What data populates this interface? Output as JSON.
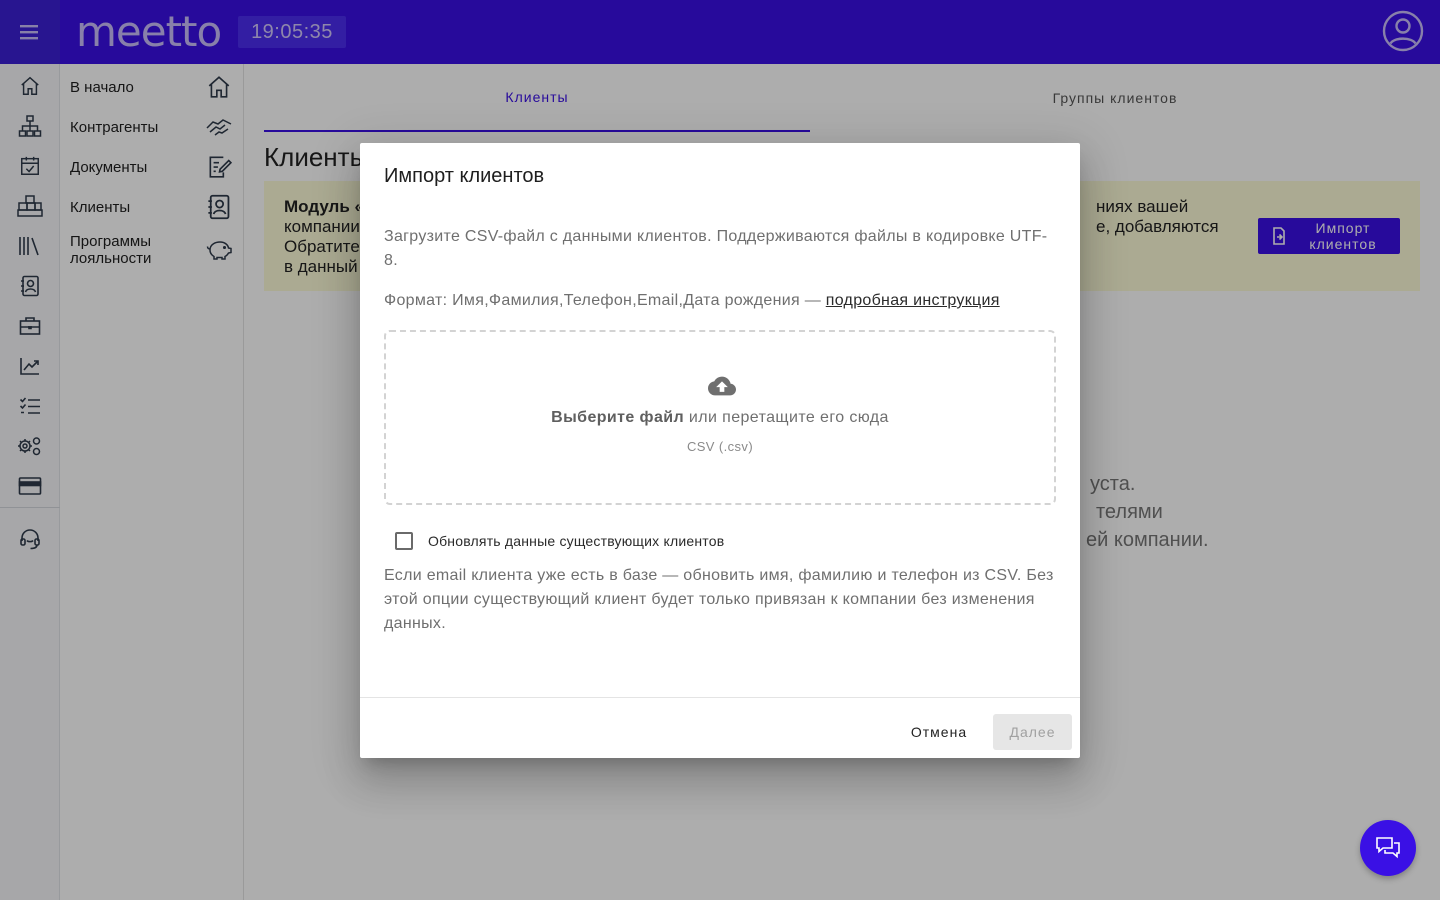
{
  "header": {
    "logo_text": "meetto",
    "clock": "19:05:35"
  },
  "rail": {
    "icons": [
      "home-icon",
      "org-structure-icon",
      "calendar-check-icon",
      "warehouse-icon",
      "library-icon",
      "contact-card-icon",
      "briefcase-icon",
      "trend-chart-icon",
      "checklist-icon",
      "settings-gears-icon",
      "credit-card-icon",
      "support-headset-icon"
    ]
  },
  "drawer": {
    "items": [
      {
        "label": "В начало",
        "icon": "home-icon"
      },
      {
        "label": "Контрагенты",
        "icon": "handshake-icon"
      },
      {
        "label": "Документы",
        "icon": "document-edit-icon"
      },
      {
        "label": "Клиенты",
        "icon": "contact-card-icon"
      },
      {
        "label": "Программы лояльности",
        "icon": "piggy-bank-icon"
      }
    ]
  },
  "main": {
    "tabs": [
      {
        "label": "Клиенты",
        "active": true
      },
      {
        "label": "Группы клиентов",
        "active": false
      }
    ],
    "title": "Клиенты",
    "notice": {
      "left_bold": "Модуль «",
      "left_line2": "компании",
      "left_line3": "Обратите",
      "left_line4": "в данный",
      "right_line1": "ниях вашей",
      "right_line2": "е, добавляются"
    },
    "import_button": "Импорт клиентов",
    "empty_line1": "уста.",
    "empty_line2": "телями",
    "empty_line3": "ей компании."
  },
  "dialog": {
    "title": "Импорт клиентов",
    "description": "Загрузите CSV-файл с данными клиентов. Поддерживаются файлы в кодировке UTF-8.",
    "format_prefix": "Формат: Имя,Фамилия,Телефон,Email,Дата рождения — ",
    "format_link": "подробная инструкция",
    "dropzone": {
      "choose": "Выберите файл",
      "drag": " или перетащите его сюда",
      "hint": "CSV (.csv)"
    },
    "checkbox_label": "Обновлять данные существующих клиентов",
    "checkbox_checked": false,
    "help_text": "Если email клиента уже есть в базе — обновить имя, фамилию и телефон из CSV. Без этой опции существующий клиент будет только привязан к компании без изменения данных.",
    "cancel": "Отмена",
    "next": "Далее"
  },
  "colors": {
    "brand": "#3a10e5",
    "notice_bg": "#fdfbd8",
    "overlay": "rgba(0,0,0,0.32)"
  }
}
